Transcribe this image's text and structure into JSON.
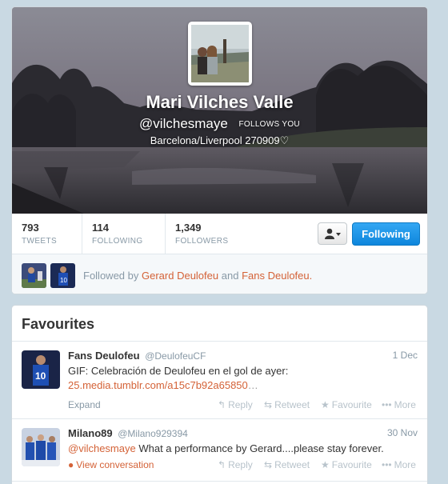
{
  "profile": {
    "name": "Mari Vilches Valle",
    "screen_name": "@vilchesmaye",
    "follows_you": "FOLLOWS YOU",
    "bio": "Barcelona/Liverpool 270909♡"
  },
  "stats": {
    "tweets": {
      "value": "793",
      "label": "TWEETS"
    },
    "following": {
      "value": "114",
      "label": "FOLLOWING"
    },
    "followers": {
      "value": "1,349",
      "label": "FOLLOWERS"
    }
  },
  "follow_button_label": "Following",
  "followed_by": {
    "prefix": "Followed by",
    "user1": "Gerard Deulofeu",
    "conjunction": "and",
    "user2": "Fans Deulofeu",
    "suffix": "."
  },
  "favourites": {
    "title": "Favourites",
    "tweets": [
      {
        "name": "Fans Deulofeu",
        "handle": "@DeulofeuCF",
        "time": "1 Dec",
        "text": "GIF: Celebración de Deulofeu en el gol de ayer:",
        "link": "25.media.tumblr.com/a15c7b92a65850",
        "ellipsis": "…",
        "secondary_action": "Expand"
      },
      {
        "name": "Milano89",
        "handle": "@Milano929394",
        "time": "30 Nov",
        "mention": "@vilchesmaye",
        "text": " What a performance by Gerard....please stay forever.",
        "secondary_action": "View conversation"
      }
    ],
    "actions": {
      "reply": "Reply",
      "retweet": "Retweet",
      "favourite": "Favourite",
      "more": "More"
    }
  },
  "colors": {
    "link": "#d46237",
    "follow_button": "#1b95e0",
    "page_background": "#c9d9e3",
    "muted_text": "#8899a6"
  }
}
